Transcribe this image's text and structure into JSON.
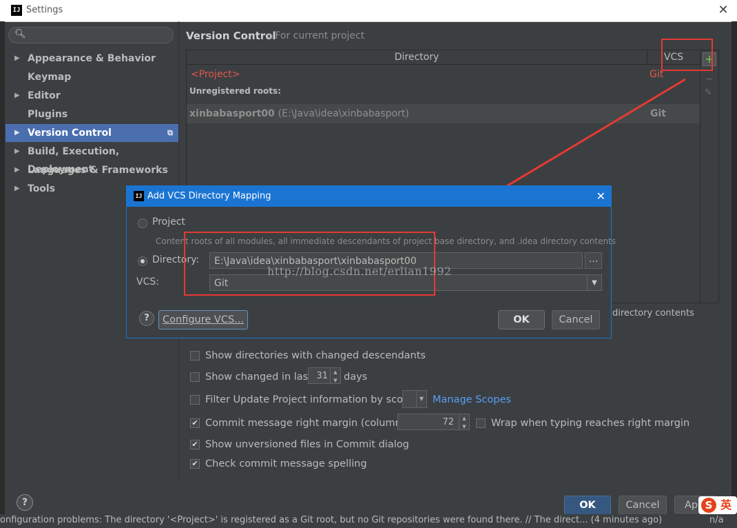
{
  "window": {
    "title": "Settings",
    "logo": "IJ"
  },
  "sidebar": {
    "search_placeholder": "",
    "items": [
      {
        "label": "Appearance & Behavior",
        "expandable": true
      },
      {
        "label": "Keymap",
        "expandable": false
      },
      {
        "label": "Editor",
        "expandable": true
      },
      {
        "label": "Plugins",
        "expandable": false
      },
      {
        "label": "Version Control",
        "expandable": true,
        "selected": true
      },
      {
        "label": "Build, Execution, Deployment",
        "expandable": true
      },
      {
        "label": "Languages & Frameworks",
        "expandable": true
      },
      {
        "label": "Tools",
        "expandable": true
      }
    ]
  },
  "header": {
    "title": "Version Control",
    "subtitle": "For current project"
  },
  "mappings": {
    "col_directory": "Directory",
    "col_vcs": "VCS",
    "project_row": {
      "directory": "<Project>",
      "vcs": "Git"
    },
    "unregistered_label": "Unregistered roots:",
    "root_row": {
      "name": "xinbabasport00",
      "path": "(E:\\Java\\idea\\xinbabasport)",
      "vcs": "Git"
    },
    "add_icon": "+",
    "overflow_text": "directory contents"
  },
  "options": {
    "show_changed_descendants": "Show directories with changed descendants",
    "show_changed_in_last": "Show changed in last",
    "days_value": "31",
    "days_label": "days",
    "filter_update": "Filter Update Project information by scope",
    "manage_scopes": "Manage Scopes",
    "commit_margin": "Commit message right margin (columns):",
    "margin_value": "72",
    "wrap_typing": "Wrap when typing reaches right margin",
    "show_unversioned": "Show unversioned files in Commit dialog",
    "check_spelling": "Check commit message spelling"
  },
  "footer": {
    "ok": "OK",
    "cancel": "Cancel",
    "apply": "Apply",
    "status_text": "onfiguration problems: The directory '<Project>' is registered as a Git root, but no Git repositories were found there. // The direct... (4 minutes ago)",
    "status_right": "n/a",
    "ime_label": "英",
    "ime_logo": "S"
  },
  "dialog": {
    "title": "Add VCS Directory Mapping",
    "logo": "IJ",
    "project_label": "Project",
    "project_hint": "Content roots of all modules, all immediate descendants of project base directory, and .idea directory contents",
    "directory_label": "Directory:",
    "directory_value": "E:\\Java\\idea\\xinbabasport\\xinbabasport00",
    "browse_label": "...",
    "vcs_label": "VCS:",
    "vcs_value": "Git",
    "configure_vcs": "Configure VCS...",
    "ok": "OK",
    "cancel": "Cancel",
    "watermark": "http://blog.csdn.net/erlian1992"
  },
  "colors": {
    "accent": "#4b6eaf",
    "dialog_accent": "#1b74d2",
    "annotation_red": "#e53935",
    "error_text": "#e5564e",
    "add_green": "#62b543"
  }
}
